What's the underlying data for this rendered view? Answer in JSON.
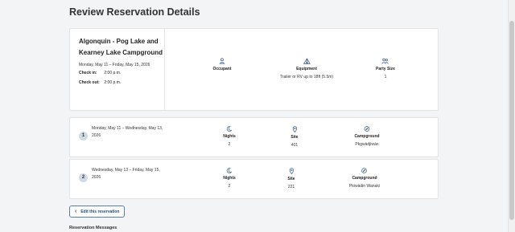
{
  "page": {
    "title": "Review Reservation Details"
  },
  "reservation": {
    "park": "Algonquin - Pog Lake and Kearney Lake Campground",
    "dates": "Monday, May 11 – Friday, May 15, 2026",
    "checkin_label": "Check in:",
    "checkin_time": "2:00 p.m.",
    "checkout_label": "Check out:",
    "checkout_time": "2:00 p.m.",
    "occupant_label": "Occupant",
    "occupant_value": "",
    "equipment_label": "Equipment",
    "equipment_value": "Trailer or RV up to 18ft (5.5m)",
    "party_label": "Party Size",
    "party_value": "1"
  },
  "segments": [
    {
      "number": "1",
      "dates": "Monday, May 11 – Wednesday, May 13, 2026",
      "nights_label": "Nights",
      "nights": "2",
      "site_label": "Site",
      "site": "401",
      "campground_label": "Campground",
      "campground": "Pkgwàdjiwàn"
    },
    {
      "number": "2",
      "dates": "Wednesday, May 13 – Friday, May 15, 2026",
      "nights_label": "Nights",
      "nights": "2",
      "site_label": "Site",
      "site": "221",
      "campground_label": "Campground",
      "campground": "Pkiwàdin Wanaki"
    }
  ],
  "actions": {
    "edit_label": "Edit this reservation"
  },
  "messages": {
    "title": "Reservation Messages"
  },
  "colors": {
    "accent": "#1f4e79",
    "badge": "#d1dbe4",
    "icon": "#3a5f85"
  },
  "icons": [
    "person-icon",
    "tent-icon",
    "group-icon",
    "moon-icon",
    "location-pin-icon",
    "compass-icon",
    "chevron-left-icon"
  ]
}
